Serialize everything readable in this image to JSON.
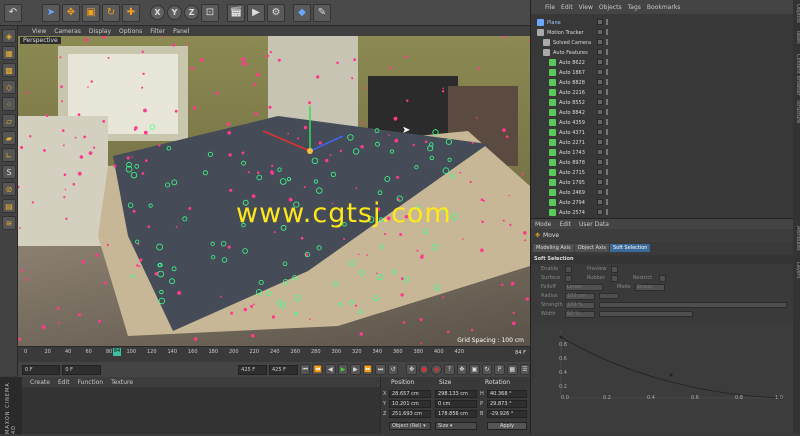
{
  "toolbar": {
    "icons": [
      "undo-icon",
      "select-arrow-icon",
      "move-icon",
      "scale-icon",
      "rotate-icon",
      "add-icon",
      "x-axis-icon",
      "y-axis-icon",
      "z-axis-icon",
      "world-icon",
      "render-icon",
      "render-view-icon",
      "render-settings-icon",
      "cube-icon",
      "pen-icon"
    ],
    "x_label": "X",
    "y_label": "Y",
    "z_label": "Z"
  },
  "viewport": {
    "menu": [
      "View",
      "Cameras",
      "Display",
      "Options",
      "Filter",
      "Panel"
    ],
    "view_name": "Perspective",
    "grid_spacing": "Grid Spacing : 100 cm",
    "watermark": "www.cgtsj.com",
    "colors": {
      "tracker_green": "#3cff8a",
      "tracker_pink": "#ff3a8a",
      "table_top": "#454c58",
      "table_edge": "#c8b796"
    }
  },
  "timeline": {
    "ticks": [
      "0",
      "20",
      "40",
      "60",
      "80",
      "100",
      "120",
      "140",
      "160",
      "180",
      "200",
      "220",
      "240",
      "260",
      "280",
      "300",
      "320",
      "340",
      "360",
      "380",
      "400",
      "420"
    ],
    "current_frame": "84 F",
    "playhead_label": "84"
  },
  "transport": {
    "start": "0 F",
    "start2": "0 F",
    "end": "425 F",
    "end2": "425 F"
  },
  "material_panel": {
    "menu": [
      "Create",
      "Edit",
      "Function",
      "Texture"
    ],
    "logo": "MAXON CINEMA 4D"
  },
  "coordinates": {
    "headers": [
      "Position",
      "Size",
      "Rotation"
    ],
    "rows": [
      {
        "axis": "X",
        "pos": "28.657 cm",
        "size": "298.133 cm",
        "rot_axis": "H",
        "rot": "40.368 °"
      },
      {
        "axis": "Y",
        "pos": "10.201 cm",
        "size": "0 cm",
        "rot_axis": "P",
        "rot": "29.873 °"
      },
      {
        "axis": "Z",
        "pos": "251.693 cm",
        "size": "178.856 cm",
        "rot_axis": "B",
        "rot": "-29.926 °"
      }
    ],
    "mode": "Object (Rel) ▾",
    "size_mode": "Size ▾",
    "apply": "Apply"
  },
  "object_manager": {
    "menu": [
      "File",
      "Edit",
      "View",
      "Objects",
      "Tags",
      "Bookmarks"
    ],
    "objects": [
      {
        "name": "Plane",
        "level": 0,
        "color": "#6aa8ff",
        "highlight": true
      },
      {
        "name": "Motion Tracker",
        "level": 0,
        "color": "#aaaaaa"
      },
      {
        "name": "Solved Camera",
        "level": 1,
        "color": "#aaaaaa"
      },
      {
        "name": "Auto Features",
        "level": 1,
        "color": "#aaaaaa"
      },
      {
        "name": "Auto 8622",
        "level": 2,
        "color": "#5ac85a"
      },
      {
        "name": "Auto 1867",
        "level": 2,
        "color": "#5ac85a"
      },
      {
        "name": "Auto 8828",
        "level": 2,
        "color": "#5ac85a"
      },
      {
        "name": "Auto 2216",
        "level": 2,
        "color": "#5ac85a"
      },
      {
        "name": "Auto 8552",
        "level": 2,
        "color": "#5ac85a"
      },
      {
        "name": "Auto 8842",
        "level": 2,
        "color": "#5ac85a"
      },
      {
        "name": "Auto 4359",
        "level": 2,
        "color": "#5ac85a"
      },
      {
        "name": "Auto 4371",
        "level": 2,
        "color": "#5ac85a"
      },
      {
        "name": "Auto 2271",
        "level": 2,
        "color": "#5ac85a"
      },
      {
        "name": "Auto 1743",
        "level": 2,
        "color": "#5ac85a"
      },
      {
        "name": "Auto 8978",
        "level": 2,
        "color": "#5ac85a"
      },
      {
        "name": "Auto 2715",
        "level": 2,
        "color": "#5ac85a"
      },
      {
        "name": "Auto 1795",
        "level": 2,
        "color": "#5ac85a"
      },
      {
        "name": "Auto 2469",
        "level": 2,
        "color": "#5ac85a"
      },
      {
        "name": "Auto 2794",
        "level": 2,
        "color": "#5ac85a"
      },
      {
        "name": "Auto 2574",
        "level": 2,
        "color": "#5ac85a"
      }
    ]
  },
  "side_tabs": [
    "Objects",
    "Takes",
    "Content Browser",
    "Structure",
    "Attributes",
    "Layers"
  ],
  "attributes": {
    "menu": [
      "Mode",
      "Edit",
      "User Data"
    ],
    "tool": "Move",
    "tabs": [
      "Modeling Axis",
      "Object Axis",
      "Soft Selection"
    ],
    "active_tab": "Soft Selection",
    "section": "Soft Selection",
    "enable": "Enable",
    "preview": "Preview",
    "surface": "Surface",
    "rubber": "Rubber",
    "restrict": "Restrict",
    "falloff": "Falloff",
    "falloff_val": "Linear",
    "mode": "Mode",
    "mode_val": "Group",
    "radius": "Radius",
    "radius_val": "100 cm",
    "strength": "Strength",
    "strength_val": "100 %",
    "width": "Width",
    "width_val": "50 %"
  },
  "graph": {
    "y_ticks": [
      "0.8",
      "0.6",
      "0.4",
      "0.2"
    ],
    "x_ticks": [
      "0.0",
      "0.2",
      "0.4",
      "0.6",
      "0.8",
      "1.0"
    ]
  }
}
